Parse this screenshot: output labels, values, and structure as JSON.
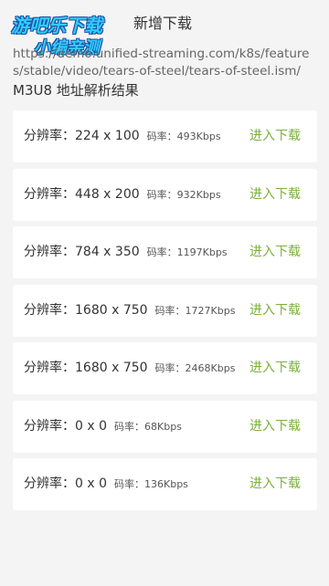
{
  "watermark": {
    "line1": "游吧乐下载",
    "line2": "小编亲测"
  },
  "header": {
    "title": "新增下载",
    "url": "https://demo.unified-streaming.com/k8s/features/stable/video/tears-of-steel/tears-of-steel.ism/",
    "section_title": "M3U8 地址解析结果"
  },
  "labels": {
    "resolution_prefix": "分辨率：",
    "rate_prefix": "码率：",
    "enter_label": "进入下载"
  },
  "streams": [
    {
      "resolution": "224 x 100",
      "rate": "493Kbps"
    },
    {
      "resolution": "448 x 200",
      "rate": "932Kbps"
    },
    {
      "resolution": "784 x 350",
      "rate": "1197Kbps"
    },
    {
      "resolution": "1680 x 750",
      "rate": "1727Kbps"
    },
    {
      "resolution": "1680 x 750",
      "rate": "2468Kbps"
    },
    {
      "resolution": "0 x 0",
      "rate": "68Kbps"
    },
    {
      "resolution": "0 x 0",
      "rate": "136Kbps"
    }
  ],
  "colors": {
    "accent_green": "#7ab03c",
    "background": "#f4f4f4",
    "card": "#ffffff"
  }
}
